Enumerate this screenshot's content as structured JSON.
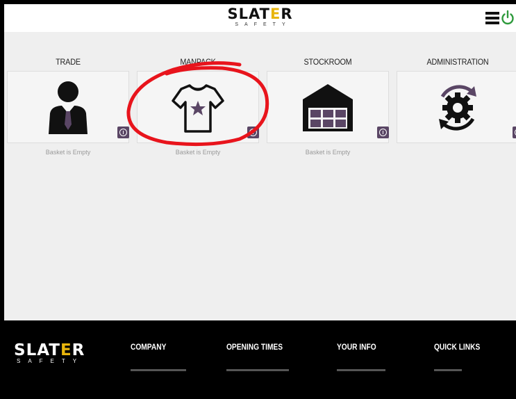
{
  "header": {
    "logo_main_pre": "SLAT",
    "logo_main_e": "E",
    "logo_main_post": "R",
    "logo_sub": "SAFETY",
    "menu_icon": "hamburger-menu-icon",
    "power_icon": "power-icon",
    "power_color": "#2e9a3c"
  },
  "categories": [
    {
      "title": "TRADE",
      "icon": "businessman-icon",
      "basket": "Basket is Empty"
    },
    {
      "title": "MANPACK",
      "icon": "tshirt-star-icon",
      "basket": "Basket is Empty"
    },
    {
      "title": "STOCKROOM",
      "icon": "warehouse-icon",
      "basket": "Basket is Empty"
    },
    {
      "title": "ADMINISTRATION",
      "icon": "gear-cycle-icon",
      "basket": ""
    }
  ],
  "accent_color": "#5a4665",
  "annotation_color": "#e8141c",
  "footer": {
    "logo_main_pre": "SLAT",
    "logo_main_e": "E",
    "logo_main_post": "R",
    "logo_sub": "SAFETY",
    "columns": [
      "COMPANY",
      "OPENING TIMES",
      "YOUR INFO",
      "QUICK LINKS"
    ]
  }
}
